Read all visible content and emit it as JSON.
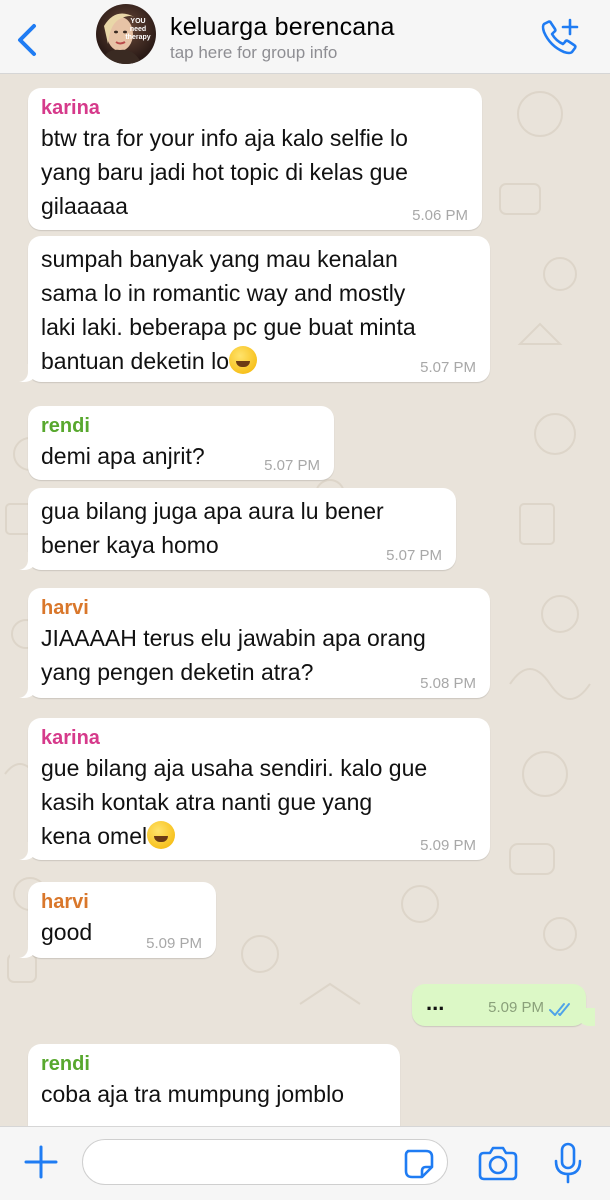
{
  "header": {
    "back_icon": "chevron-left-icon",
    "title": "keluarga berencana",
    "subtitle": "tap here for group info",
    "avatar_text": "YOU need therapy",
    "call_icon": "phone-plus-icon"
  },
  "colors": {
    "accent": "#1f7cf3",
    "karina": "#d63a8b",
    "rendi": "#58a82e",
    "harvi": "#d9772b",
    "outgoing_bubble": "#dcf8c6",
    "read_ticks": "#4fa3e8"
  },
  "messages": [
    {
      "sender": "karina",
      "text": "btw tra for your info aja kalo selfie lo\nyang baru jadi hot topic di kelas gue\ngilaaaaa",
      "time": "5.06 PM"
    },
    {
      "sender": "",
      "text": "sumpah banyak yang mau kenalan\nsama lo in romantic way and mostly\nlaki laki. beberapa pc gue buat minta\nbantuan deketin lo",
      "emoji": "rofl-emoji",
      "time": "5.07 PM"
    },
    {
      "sender": "rendi",
      "text": "demi apa anjrit?",
      "time": "5.07 PM"
    },
    {
      "sender": "",
      "text": "gua bilang juga apa aura lu bener\nbener kaya homo",
      "time": "5.07 PM"
    },
    {
      "sender": "harvi",
      "text": "JIAAAAH terus elu jawabin apa orang\nyang pengen deketin atra?",
      "time": "5.08 PM"
    },
    {
      "sender": "karina",
      "text": "gue bilang aja usaha sendiri. kalo gue\nkasih kontak atra nanti gue yang\nkena omel",
      "emoji": "grin-emoji",
      "time": "5.09 PM"
    },
    {
      "sender": "harvi",
      "text": "good",
      "time": "5.09 PM"
    },
    {
      "sender": "rendi",
      "text": "coba aja tra mumpung jomblo",
      "time": ""
    }
  ],
  "outgoing": {
    "text": "...",
    "time": "5.09 PM",
    "status_icon": "double-check-icon"
  },
  "composer": {
    "value": "",
    "plus_icon": "plus-icon",
    "sticker_icon": "sticker-icon",
    "camera_icon": "camera-icon",
    "mic_icon": "microphone-icon"
  }
}
